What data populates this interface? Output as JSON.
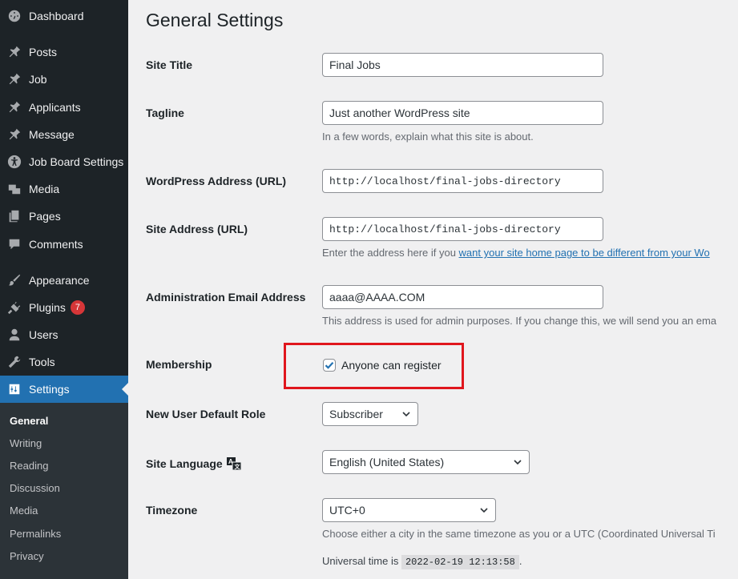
{
  "colors": {
    "sidebar_bg": "#1d2327",
    "active_bg": "#2271b1",
    "link": "#2271b1",
    "badge": "#d63638",
    "highlight": "#e0161d"
  },
  "sidebar": {
    "items": [
      {
        "label": "Dashboard",
        "icon": "dashboard-icon"
      },
      {
        "label": "Posts",
        "icon": "pin-icon"
      },
      {
        "label": "Job",
        "icon": "pin-icon"
      },
      {
        "label": "Applicants",
        "icon": "pin-icon"
      },
      {
        "label": "Message",
        "icon": "pin-icon"
      },
      {
        "label": "Job Board Settings",
        "icon": "universal-access-icon"
      },
      {
        "label": "Media",
        "icon": "media-icon"
      },
      {
        "label": "Pages",
        "icon": "pages-icon"
      },
      {
        "label": "Comments",
        "icon": "comment-icon"
      },
      {
        "label": "Appearance",
        "icon": "brush-icon"
      },
      {
        "label": "Plugins",
        "icon": "plugin-icon",
        "badge": "7"
      },
      {
        "label": "Users",
        "icon": "user-icon"
      },
      {
        "label": "Tools",
        "icon": "wrench-icon"
      },
      {
        "label": "Settings",
        "icon": "settings-icon",
        "active": true
      }
    ],
    "submenu": [
      "General",
      "Writing",
      "Reading",
      "Discussion",
      "Media",
      "Permalinks",
      "Privacy"
    ]
  },
  "page": {
    "title": "General Settings",
    "site_title": {
      "label": "Site Title",
      "value": "Final Jobs"
    },
    "tagline": {
      "label": "Tagline",
      "value": "Just another WordPress site",
      "desc": "In a few words, explain what this site is about."
    },
    "wp_address": {
      "label": "WordPress Address (URL)",
      "value": "http://localhost/final-jobs-directory"
    },
    "site_address": {
      "label": "Site Address (URL)",
      "value": "http://localhost/final-jobs-directory",
      "desc_prefix": "Enter the address here if you ",
      "desc_link": "want your site home page to be different from your Wo"
    },
    "admin_email": {
      "label": "Administration Email Address",
      "value": "aaaa@AAAA.COM",
      "desc": "This address is used for admin purposes. If you change this, we will send you an ema"
    },
    "membership": {
      "label": "Membership",
      "checkbox_label": "Anyone can register",
      "checked": true
    },
    "default_role": {
      "label": "New User Default Role",
      "value": "Subscriber"
    },
    "language": {
      "label": "Site Language",
      "value": "English (United States)",
      "icon": "translation-icon"
    },
    "timezone": {
      "label": "Timezone",
      "value": "UTC+0",
      "desc": "Choose either a city in the same timezone as you or a UTC (Coordinated Universal Ti",
      "universal_prefix": "Universal time is",
      "universal_time": "2022-02-19 12:13:58",
      "universal_suffix": "."
    }
  }
}
